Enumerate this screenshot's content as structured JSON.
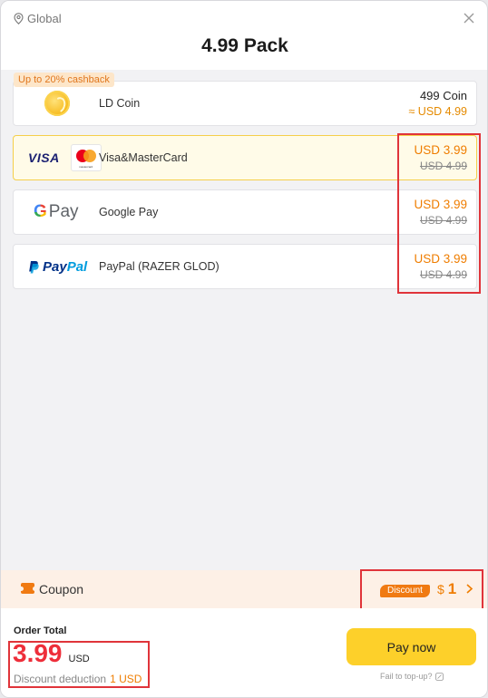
{
  "header": {
    "region": "Global",
    "title": "4.99 Pack"
  },
  "cashback_badge": "Up to 20% cashback",
  "methods": [
    {
      "name": "LD Coin",
      "amount": "499 Coin",
      "approx": "≈ USD 4.99",
      "logo": "ld-coin"
    },
    {
      "name": "Visa&MasterCard",
      "price": "USD 3.99",
      "original": "USD 4.99",
      "logo": "visa-mastercard",
      "visa_text": "VISA",
      "mc_text": "mastercard",
      "selected": true
    },
    {
      "name": "Google Pay",
      "price": "USD 3.99",
      "original": "USD 4.99",
      "logo": "google-pay",
      "gpay_g": "G",
      "gpay_text": "Pay"
    },
    {
      "name": "PayPal (RAZER GLOD)",
      "price": "USD 3.99",
      "original": "USD 4.99",
      "logo": "paypal",
      "pp_text1": "Pay",
      "pp_text2": "Pal"
    }
  ],
  "coupon": {
    "label": "Coupon",
    "badge": "Discount",
    "currency": "$",
    "value": "1"
  },
  "order": {
    "label": "Order Total",
    "amount": "3.99",
    "currency": "USD",
    "deduction_label": "Discount deduction",
    "deduction_value": "1 USD"
  },
  "pay_button": "Pay now",
  "fail_link": "Fail to top-up?",
  "colors": {
    "accent": "#ef7d00",
    "pay_button": "#fdd02a",
    "highlight_box": "#e0343a",
    "total": "#ee2e3a"
  }
}
